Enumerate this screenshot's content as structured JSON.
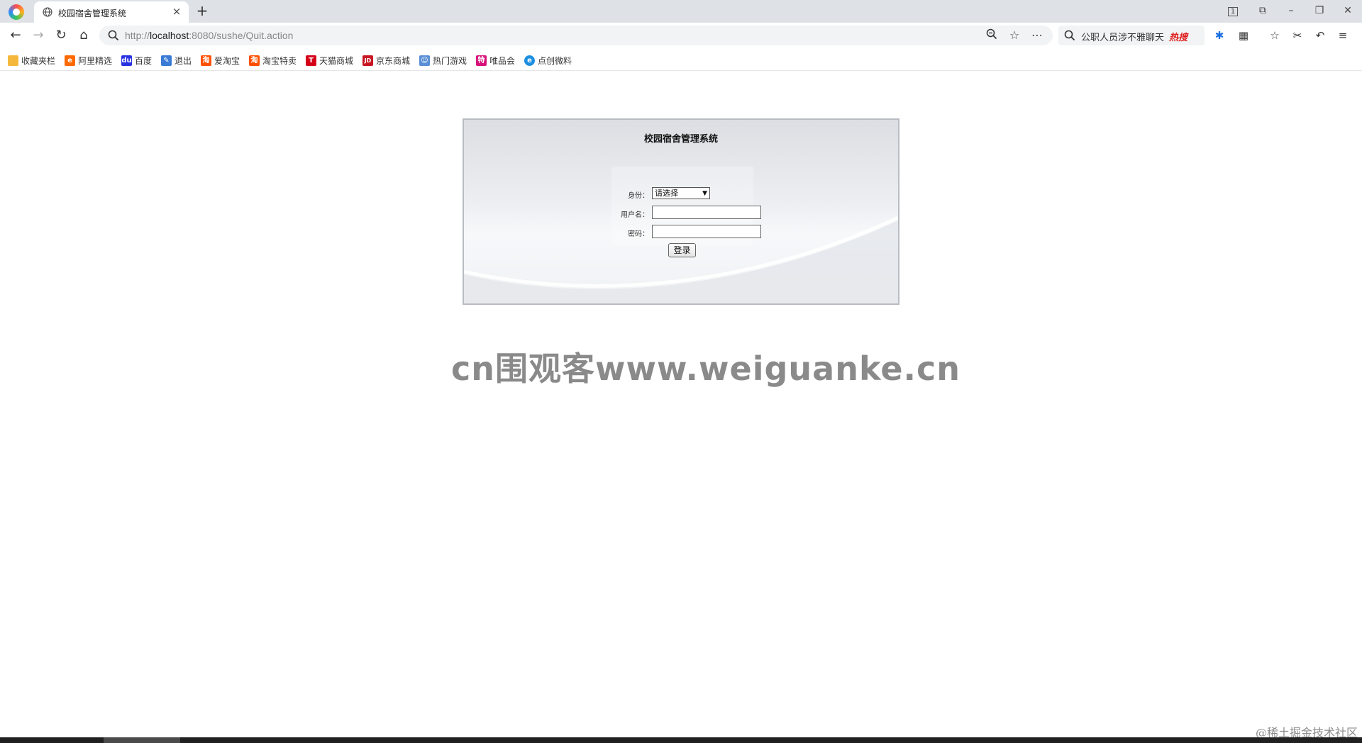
{
  "browser": {
    "tab": {
      "title": "校园宿舍管理系统",
      "close_glyph": "×"
    },
    "new_tab_glyph": "+",
    "window_controls": [
      "1",
      "⧉",
      "–",
      "❐",
      "✕"
    ],
    "address": {
      "url_prefix": "http://",
      "url_host": "localhost",
      "url_rest": ":8080/sushe/Quit.action"
    },
    "hot_search": {
      "text": "公职人员涉不雅聊天",
      "badge": "热搜"
    },
    "nav_glyphs": {
      "back": "←",
      "forward": "→",
      "reload": "↻",
      "home": "⌂"
    }
  },
  "bookmarks": [
    {
      "label": "收藏夹栏",
      "icon": "folder-icon",
      "color": "#f5b83d",
      "glyph": ""
    },
    {
      "label": "阿里精选",
      "icon": "alibaba-icon",
      "color": "#ff6a00",
      "glyph": "e"
    },
    {
      "label": "百度",
      "icon": "baidu-icon",
      "color": "#2932e1",
      "glyph": "du"
    },
    {
      "label": "退出",
      "icon": "feather-icon",
      "color": "#3a7bd5",
      "glyph": "✎"
    },
    {
      "label": "爱淘宝",
      "icon": "taobao-icon",
      "color": "#ff5000",
      "glyph": "淘"
    },
    {
      "label": "淘宝特卖",
      "icon": "taobao-icon",
      "color": "#ff5000",
      "glyph": "淘"
    },
    {
      "label": "天猫商城",
      "icon": "tmall-icon",
      "color": "#d4001a",
      "glyph": "T"
    },
    {
      "label": "京东商城",
      "icon": "jd-icon",
      "color": "#c81623",
      "glyph": "JD"
    },
    {
      "label": "热门游戏",
      "icon": "game-icon",
      "color": "#5a8fd6",
      "glyph": "☺"
    },
    {
      "label": "唯品会",
      "icon": "vip-icon",
      "color": "#d6127a",
      "glyph": "特"
    },
    {
      "label": "点创微料",
      "icon": "edge-icon",
      "color": "#1d8fe1",
      "glyph": "e"
    }
  ],
  "login": {
    "title": "校园宿舍管理系统",
    "role_label": "身份：",
    "role_selected": "请选择",
    "username_label": "用户名：",
    "password_label": "密码：",
    "username_value": "",
    "password_value": "",
    "submit_label": "登录"
  },
  "watermark": "cn围观客www.weiguanke.cn",
  "corner_watermark": "@稀土掘金技术社区",
  "colors": {
    "panel_border": "#b9bcc2",
    "hot_badge": "#e02020"
  }
}
